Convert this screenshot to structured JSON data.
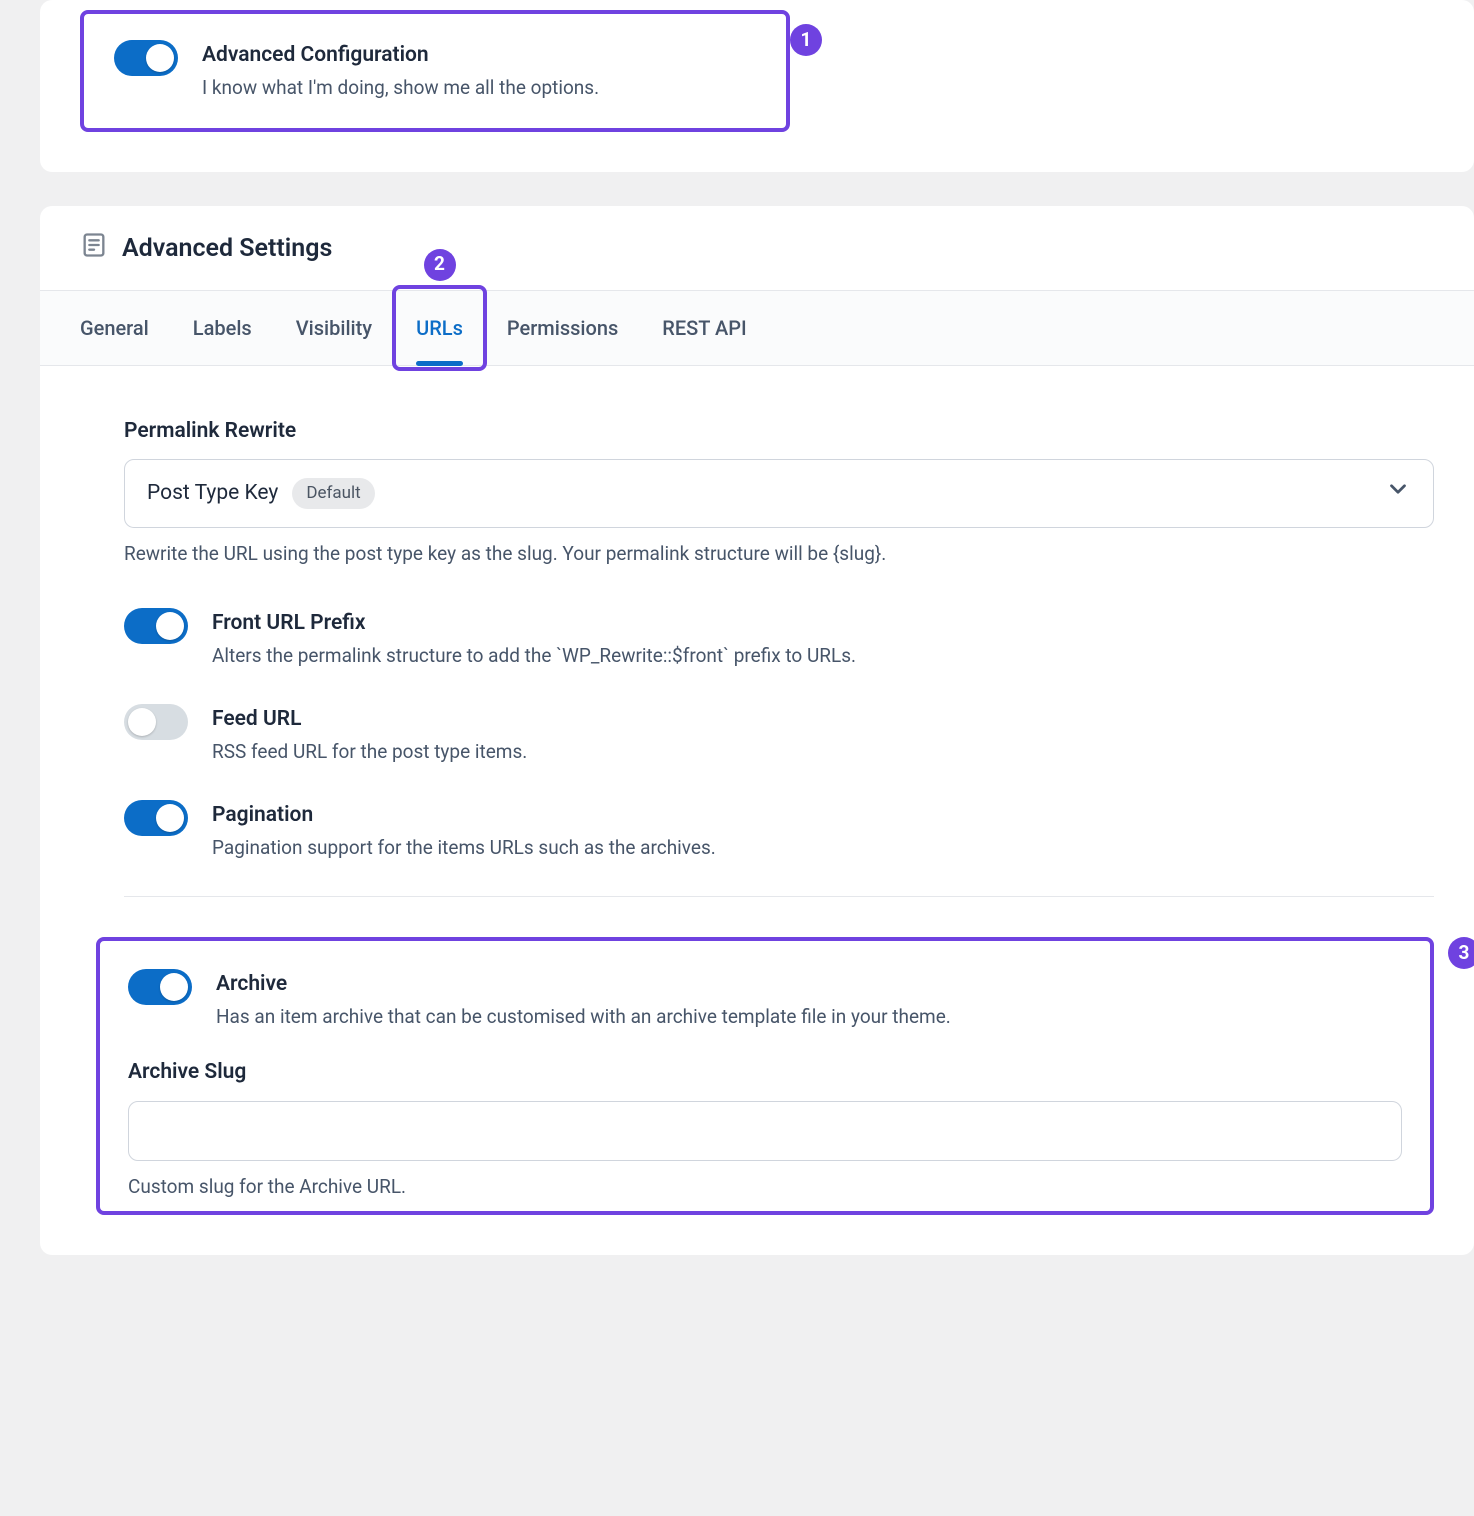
{
  "callouts": {
    "c1": "1",
    "c2": "2",
    "c3": "3"
  },
  "advanced_config": {
    "title": "Advanced Configuration",
    "desc": "I know what I'm doing, show me all the options.",
    "on": true
  },
  "section_title": "Advanced Settings",
  "tabs": {
    "general": "General",
    "labels": "Labels",
    "visibility": "Visibility",
    "urls": "URLs",
    "permissions": "Permissions",
    "rest_api": "REST API"
  },
  "permalink": {
    "label": "Permalink Rewrite",
    "value": "Post Type Key",
    "badge": "Default",
    "help": "Rewrite the URL using the post type key as the slug. Your permalink structure will be {slug}."
  },
  "toggles": {
    "front_prefix": {
      "title": "Front URL Prefix",
      "desc": "Alters the permalink structure to add the `WP_Rewrite::$front` prefix to URLs.",
      "on": true
    },
    "feed_url": {
      "title": "Feed URL",
      "desc": "RSS feed URL for the post type items.",
      "on": false
    },
    "pagination": {
      "title": "Pagination",
      "desc": "Pagination support for the items URLs such as the archives.",
      "on": true
    },
    "archive": {
      "title": "Archive",
      "desc": "Has an item archive that can be customised with an archive template file in your theme.",
      "on": true
    }
  },
  "archive_slug": {
    "label": "Archive Slug",
    "value": "",
    "help": "Custom slug for the Archive URL."
  }
}
